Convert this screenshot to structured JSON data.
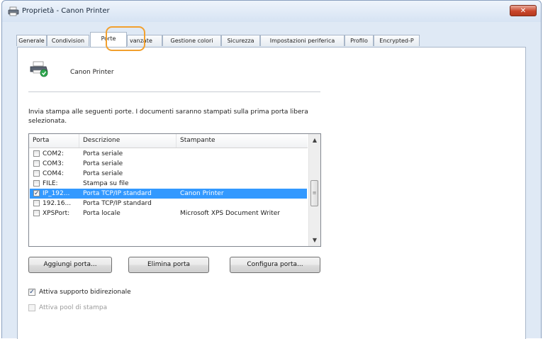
{
  "window": {
    "title": "Proprietà - Canon Printer",
    "close_glyph": "✕"
  },
  "tabs": [
    {
      "label": "Generale"
    },
    {
      "label": "Condivision"
    },
    {
      "label": "Porte",
      "active": true
    },
    {
      "label": "vanzate"
    },
    {
      "label": "Gestione colori"
    },
    {
      "label": "Sicurezza"
    },
    {
      "label": "Impostazioni periferica"
    },
    {
      "label": "Profilo"
    },
    {
      "label": "Encrypted-P"
    }
  ],
  "printer": {
    "name": "Canon Printer",
    "icon": "printer-icon"
  },
  "description": "Invia stampa alle seguenti porte. I documenti saranno stampati sulla prima porta libera selezionata.",
  "ports": {
    "columns": [
      "Porta",
      "Descrizione",
      "Stampante"
    ],
    "rows": [
      {
        "checked": false,
        "port": "COM2:",
        "desc": "Porta seriale",
        "printer": ""
      },
      {
        "checked": false,
        "port": "COM3:",
        "desc": "Porta seriale",
        "printer": ""
      },
      {
        "checked": false,
        "port": "COM4:",
        "desc": "Porta seriale",
        "printer": ""
      },
      {
        "checked": false,
        "port": "FILE:",
        "desc": "Stampa su file",
        "printer": ""
      },
      {
        "checked": true,
        "selected": true,
        "port": "IP_192...",
        "desc": "Porta TCP/IP standard",
        "printer": "Canon Printer"
      },
      {
        "checked": false,
        "port": "192.16...",
        "desc": "Porta TCP/IP standard",
        "printer": ""
      },
      {
        "checked": false,
        "port": "XPSPort:",
        "desc": "Porta locale",
        "printer": "Microsoft XPS Document Writer"
      }
    ],
    "scroll_up_glyph": "▲",
    "scroll_down_glyph": "▼",
    "thumb_grip": "≡"
  },
  "buttons": {
    "add": "Aggiungi porta...",
    "delete": "Elimina porta",
    "configure": "Configura porta..."
  },
  "options": {
    "bidirectional": {
      "label": "Attiva supporto bidirezionale",
      "checked": true
    },
    "pool": {
      "label": "Attiva pool di stampa",
      "checked": false,
      "disabled": true
    }
  },
  "check_glyph": "✓",
  "colors": {
    "selection": "#3399ff",
    "tab_highlight": "#f2a02e",
    "close_button": "#c9462b"
  }
}
